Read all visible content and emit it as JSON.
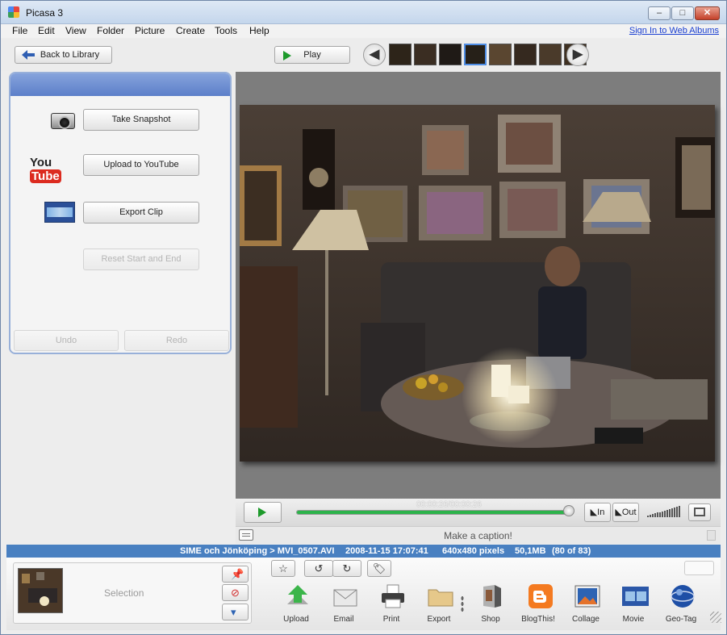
{
  "window": {
    "title": "Picasa 3",
    "min_glyph": "–",
    "max_glyph": "□",
    "close_glyph": "✕"
  },
  "menu": {
    "items": [
      "File",
      "Edit",
      "View",
      "Folder",
      "Picture",
      "Create",
      "Tools",
      "Help"
    ],
    "signin_link": "Sign In to Web Albums"
  },
  "toolbar": {
    "back_label": "Back to Library",
    "play_label": "Play",
    "prev_glyph": "◀",
    "next_glyph": "▶",
    "thumbnail_count": 8,
    "selected_thumbnail_index": 3,
    "thumbnail_colors": [
      "#2d2419",
      "#3a2d22",
      "#1f1a16",
      "#262018",
      "#5a4630",
      "#35291f",
      "#4a3a2a",
      "#3f3020"
    ]
  },
  "left_panel": {
    "take_snapshot": "Take Snapshot",
    "youtube_logo_you": "You",
    "youtube_logo_tube": "Tube",
    "upload_youtube": "Upload to YouTube",
    "export_clip": "Export Clip",
    "reset_start_end": "Reset Start and End",
    "undo": "Undo",
    "redo": "Redo"
  },
  "player": {
    "time": "00:00:26/00:00:26",
    "progress": 1.0,
    "in_label": "In",
    "out_label": "Out",
    "caption_placeholder": "Make a caption!"
  },
  "status": {
    "path": "SIME och Jönköping > MVI_0507.AVI",
    "datetime": "2008-11-15 17:07:41",
    "dimensions": "640x480 pixels",
    "size": "50,1MB",
    "count": "(80 of 83)"
  },
  "selection": {
    "label": "Selection",
    "hold_glyph": "📌",
    "clear_glyph": "⊘",
    "album_glyph": "▾"
  },
  "quick_tools": {
    "star": "☆",
    "rotate_left": "↺",
    "rotate_right": "↻",
    "label": "🏷"
  },
  "actions": [
    {
      "label": "Upload",
      "icon": "upload-icon",
      "color": "#3bb54a"
    },
    {
      "label": "Email",
      "icon": "email-icon",
      "color": "#e9e9e9"
    },
    {
      "label": "Print",
      "icon": "print-icon",
      "color": "#3d3d3d"
    },
    {
      "label": "Export",
      "icon": "export-icon",
      "color": "#e6c88a"
    },
    {
      "label": "Shop",
      "icon": "shop-icon",
      "color": "#b0b0b0"
    },
    {
      "label": "BlogThis!",
      "icon": "blogger-icon",
      "color": "#f47a20"
    },
    {
      "label": "Collage",
      "icon": "collage-icon",
      "color": "#2d63b3"
    },
    {
      "label": "Movie",
      "icon": "movie-icon",
      "color": "#2b57a8"
    },
    {
      "label": "Geo-Tag",
      "icon": "geotag-icon",
      "color": "#1e4fa6"
    }
  ]
}
